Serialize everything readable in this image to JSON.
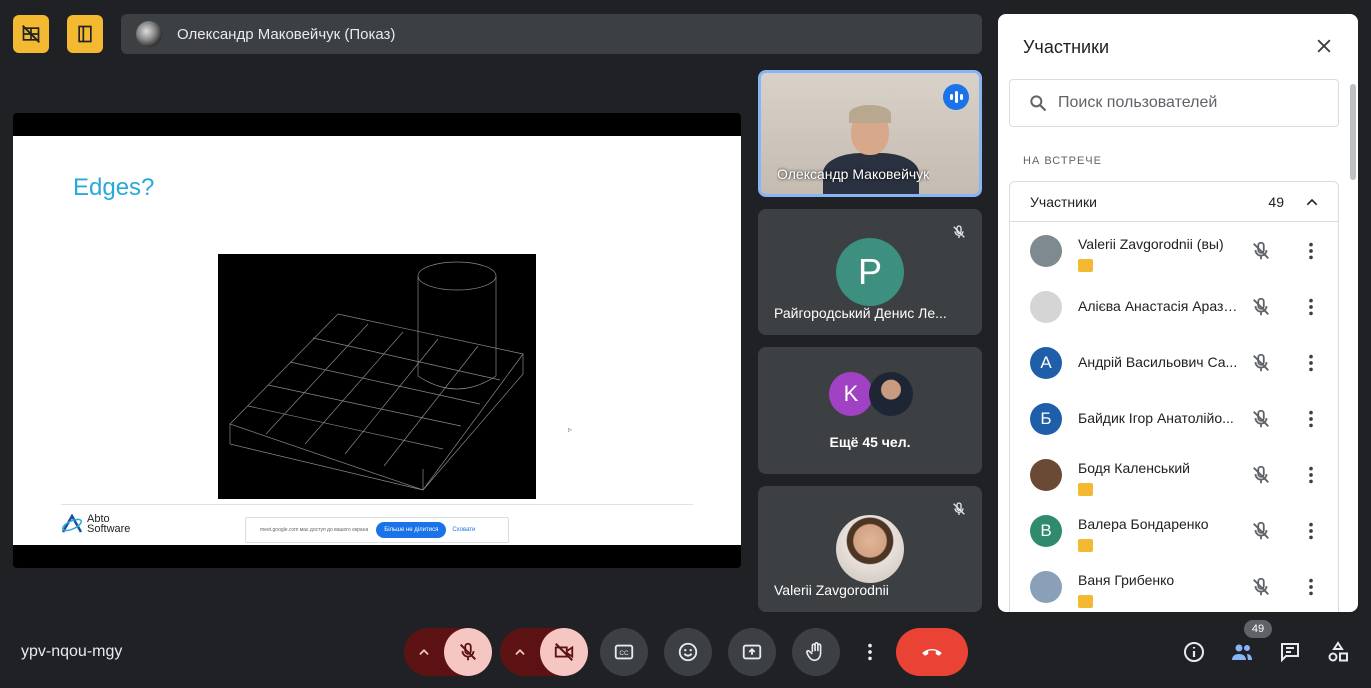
{
  "presenter_bar": {
    "name": "Олександр Маковейчук (Показ)"
  },
  "slide": {
    "title": "Edges?",
    "logo_line1": "Abto",
    "logo_line2": "Software",
    "share_message": "meet.google.com має доступ до вашого екрана",
    "share_stop": "Більше не ділитися",
    "share_hide": "Сховати"
  },
  "tiles": [
    {
      "name": "Олександр Маковейчук",
      "speaking": true
    },
    {
      "name": "Райгородський Денис Ле...",
      "initial": "P",
      "color": "#3d8f80",
      "muted": true
    },
    {
      "more": "Ещё 45 чел.",
      "initial": "K",
      "color": "#a142c4"
    },
    {
      "name": "Valerii Zavgorodnii",
      "muted": true
    }
  ],
  "panel": {
    "title": "Участники",
    "search_placeholder": "Поиск пользователей",
    "section": "НА ВСТРЕЧЕ",
    "group_label": "Участники",
    "group_count": "49",
    "participants": [
      {
        "name": "Valerii Zavgorodnii (вы)",
        "avatar": "photo",
        "color": "#7e8a8f",
        "badge": true
      },
      {
        "name": "Алієва Анастасія Аразі...",
        "avatar": "photo",
        "color": "#d5d5d5",
        "badge": false
      },
      {
        "name": "Андрій Васильович Са...",
        "initial": "А",
        "color": "#1f5faa",
        "badge": false
      },
      {
        "name": "Байдик Ігор Анатолійо...",
        "initial": "Б",
        "color": "#1f5faa",
        "badge": false
      },
      {
        "name": "Бодя Каленський",
        "avatar": "photo",
        "color": "#6b4a35",
        "badge": true
      },
      {
        "name": "Валера Бондаренко",
        "initial": "В",
        "color": "#2f8a6e",
        "badge": true
      },
      {
        "name": "Ваня Грибенко",
        "avatar": "photo",
        "color": "#8aa0b8",
        "badge": true
      }
    ]
  },
  "bottom": {
    "meeting_code": "ypv-nqou-mgy",
    "people_count": "49"
  },
  "colors": {
    "accent_yellow": "#f2b931",
    "end_call": "#ea4335",
    "bg": "#202124"
  }
}
